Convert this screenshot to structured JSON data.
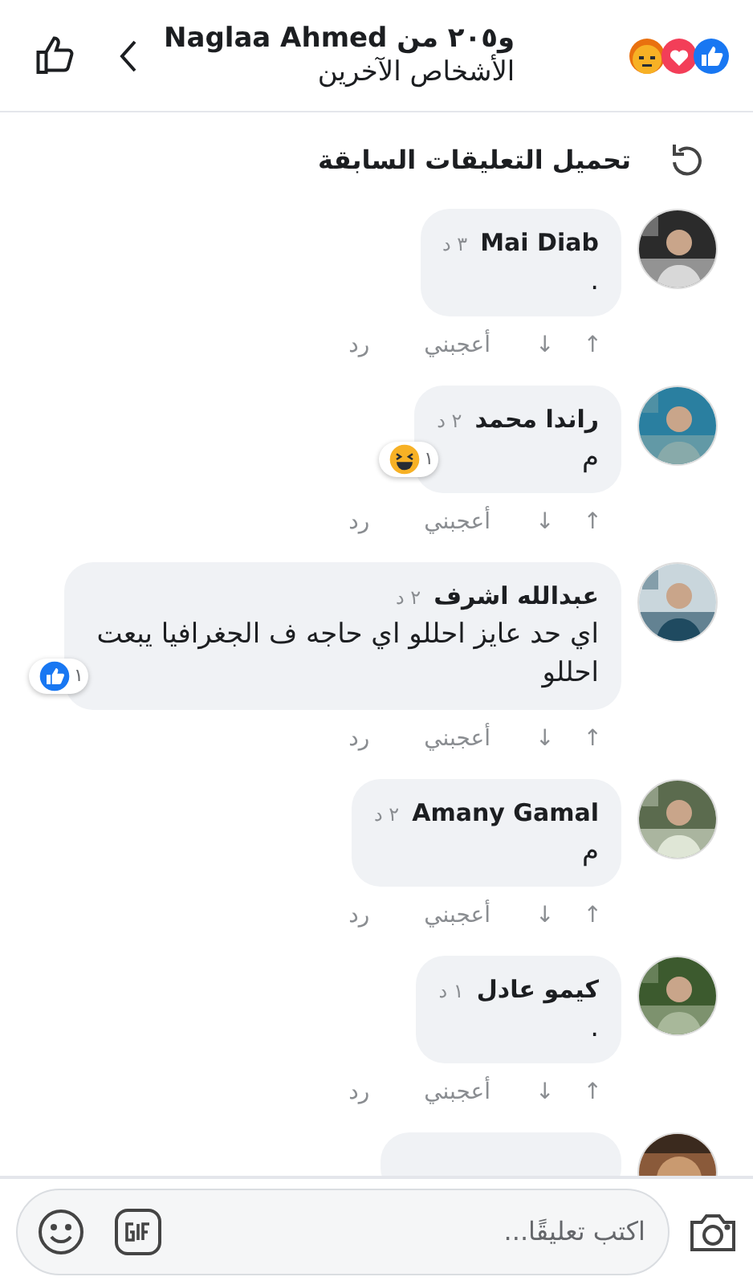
{
  "header": {
    "reactions": [
      {
        "kind": "angry"
      },
      {
        "kind": "love"
      },
      {
        "kind": "like"
      }
    ],
    "title": "و٢٠٥ من Naglaa Ahmed",
    "subtitle": "الأشخاص الآخرين"
  },
  "load_previous": {
    "label": "تحميل التعليقات السابقة"
  },
  "comments": [
    {
      "author": "Mai Diab",
      "time": "٣ د",
      "text": ".",
      "actions": {
        "up": "↑",
        "down": "↓",
        "like": "أعجبني",
        "reply": "رد"
      }
    },
    {
      "author": "راندا محمد",
      "time": "٢ د",
      "text": "م",
      "reaction": {
        "kind": "haha",
        "count": "١"
      },
      "actions": {
        "up": "↑",
        "down": "↓",
        "like": "أعجبني",
        "reply": "رد"
      }
    },
    {
      "author": "عبدالله اشرف",
      "time": "٢ د",
      "text": "اي حد عايز احللو اي حاجه ف الجغرافيا يبعت احللو",
      "reaction": {
        "kind": "like",
        "count": "١"
      },
      "actions": {
        "up": "↑",
        "down": "↓",
        "like": "أعجبني",
        "reply": "رد"
      }
    },
    {
      "author": "Amany Gamal",
      "time": "٢ د",
      "text": "م",
      "actions": {
        "up": "↑",
        "down": "↓",
        "like": "أعجبني",
        "reply": "رد"
      }
    },
    {
      "author": "كيمو عادل",
      "time": "١ د",
      "text": ".",
      "actions": {
        "up": "↑",
        "down": "↓",
        "like": "أعجبني",
        "reply": "رد"
      }
    }
  ],
  "composer": {
    "placeholder": "اكتب تعليقًا..."
  }
}
